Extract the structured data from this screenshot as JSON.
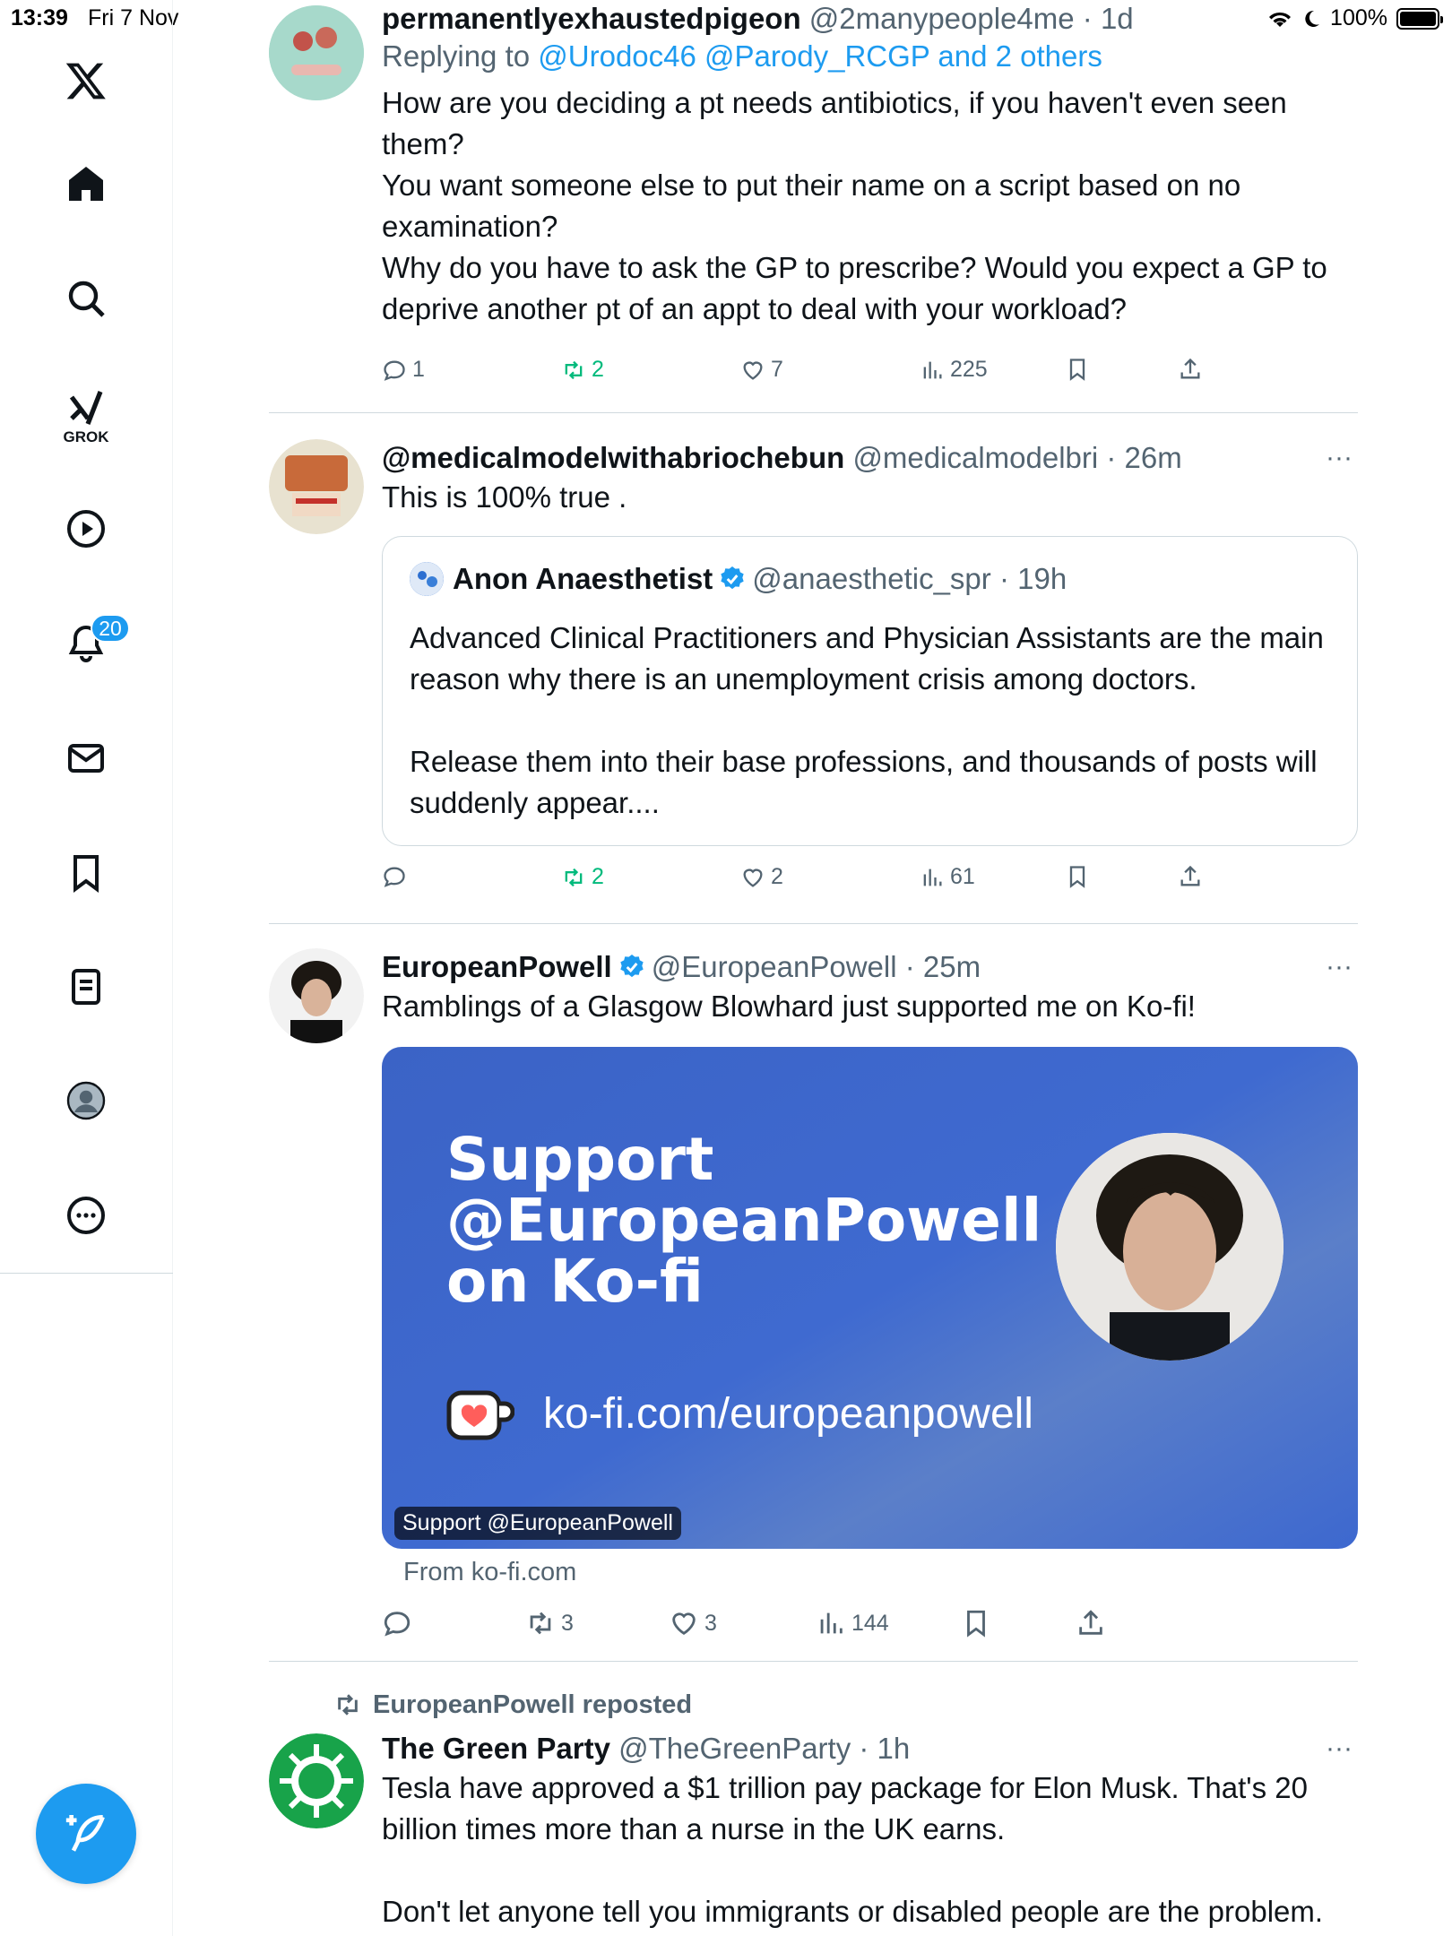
{
  "status_bar": {
    "time": "13:39",
    "date": "Fri 7 Nov",
    "battery": "100%"
  },
  "sidebar": {
    "grok_label": "GROK",
    "notifications_badge": "20"
  },
  "tweets": [
    {
      "name": "permanentlyexhaustedpigeon",
      "handle": "@2manypeople4me",
      "time": "1d",
      "reply_prefix": "Replying to",
      "reply_mentions": "@Urodoc46 @Parody_RCGP and 2 others",
      "text": "How are you deciding a pt needs antibiotics, if you haven't even seen them?\nYou want someone else to put their name on a script based on no examination?\nWhy do you have to ask the GP to prescribe? Would you expect a GP to deprive another pt of an appt to deal with your workload?",
      "replies": "1",
      "reposts": "2",
      "likes": "7",
      "views": "225"
    },
    {
      "name": "@medicalmodelwithabriochebun",
      "handle": "@medicalmodelbri",
      "time": "26m",
      "text": "This is 100% true .",
      "quote": {
        "name": "Anon Anaesthetist",
        "handle": "@anaesthetic_spr",
        "time": "19h",
        "text": "Advanced Clinical Practitioners and Physician Assistants are the main reason why there is an unemployment crisis among doctors.\n\nRelease them into their base professions, and thousands of posts will suddenly appear...."
      },
      "replies": "",
      "reposts": "2",
      "likes": "2",
      "views": "61"
    },
    {
      "name": "EuropeanPowell",
      "handle": "@EuropeanPowell",
      "time": "25m",
      "text": "Ramblings of a Glasgow Blowhard just supported me on Ko-fi!",
      "card": {
        "title": "Support\n@EuropeanPowell\non Ko-fi",
        "url": "ko-fi.com/europeanpowell",
        "overlay": "Support @EuropeanPowell",
        "from": "From ko-fi.com"
      },
      "replies": "",
      "reposts": "3",
      "likes": "3",
      "views": "144"
    },
    {
      "repost_by": "EuropeanPowell reposted",
      "name": "The Green Party",
      "handle": "@TheGreenParty",
      "time": "1h",
      "text": "Tesla have approved a $1 trillion pay package for Elon Musk. That's 20 billion times more than a nurse in the UK earns.\n\nDon't let anyone tell you immigrants or disabled people are the problem."
    }
  ],
  "colors": {
    "accent": "#1d9bf0",
    "repost_green": "#00ba7c",
    "muted": "#536471",
    "kofi_blue": "#3f6ad0"
  }
}
